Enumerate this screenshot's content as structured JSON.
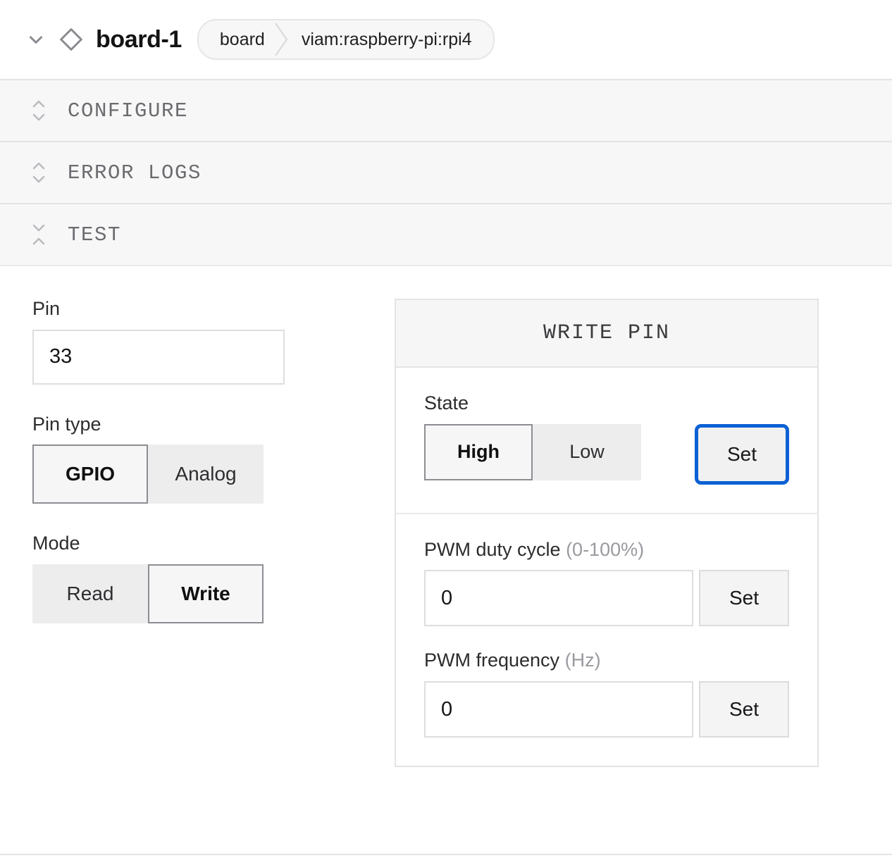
{
  "header": {
    "expand_icon": "chevron-down-icon",
    "component_icon": "diamond-icon",
    "title": "board-1",
    "breadcrumb": {
      "type": "board",
      "model": "viam:raspberry-pi:rpi4"
    }
  },
  "sections": [
    {
      "label": "CONFIGURE",
      "icon": "expand-chevrons-icon",
      "state": "collapsed"
    },
    {
      "label": "ERROR LOGS",
      "icon": "expand-chevrons-icon",
      "state": "collapsed"
    },
    {
      "label": "TEST",
      "icon": "collapse-chevrons-icon",
      "state": "expanded"
    }
  ],
  "test_panel": {
    "pin": {
      "label": "Pin",
      "value": "33",
      "placeholder": ""
    },
    "pin_type": {
      "label": "Pin type",
      "options": [
        "GPIO",
        "Analog"
      ],
      "selected": "GPIO"
    },
    "mode": {
      "label": "Mode",
      "options": [
        "Read",
        "Write"
      ],
      "selected": "Write"
    },
    "write_pin_card": {
      "title": "WRITE PIN",
      "state": {
        "label": "State",
        "options": [
          "High",
          "Low"
        ],
        "selected": "High",
        "set_label": "Set",
        "set_focused": true
      },
      "duty_cycle": {
        "label": "PWM duty cycle",
        "label_suffix": "(0-100%)",
        "value": "0",
        "set_label": "Set"
      },
      "frequency": {
        "label": "PWM frequency",
        "label_suffix": "(Hz)",
        "value": "0",
        "set_label": "Set"
      }
    }
  },
  "colors": {
    "focus_blue": "#0b61d4",
    "selected_border": "#8d8d93",
    "muted_text": "#9a9aa0",
    "section_label": "#6b6b70"
  }
}
